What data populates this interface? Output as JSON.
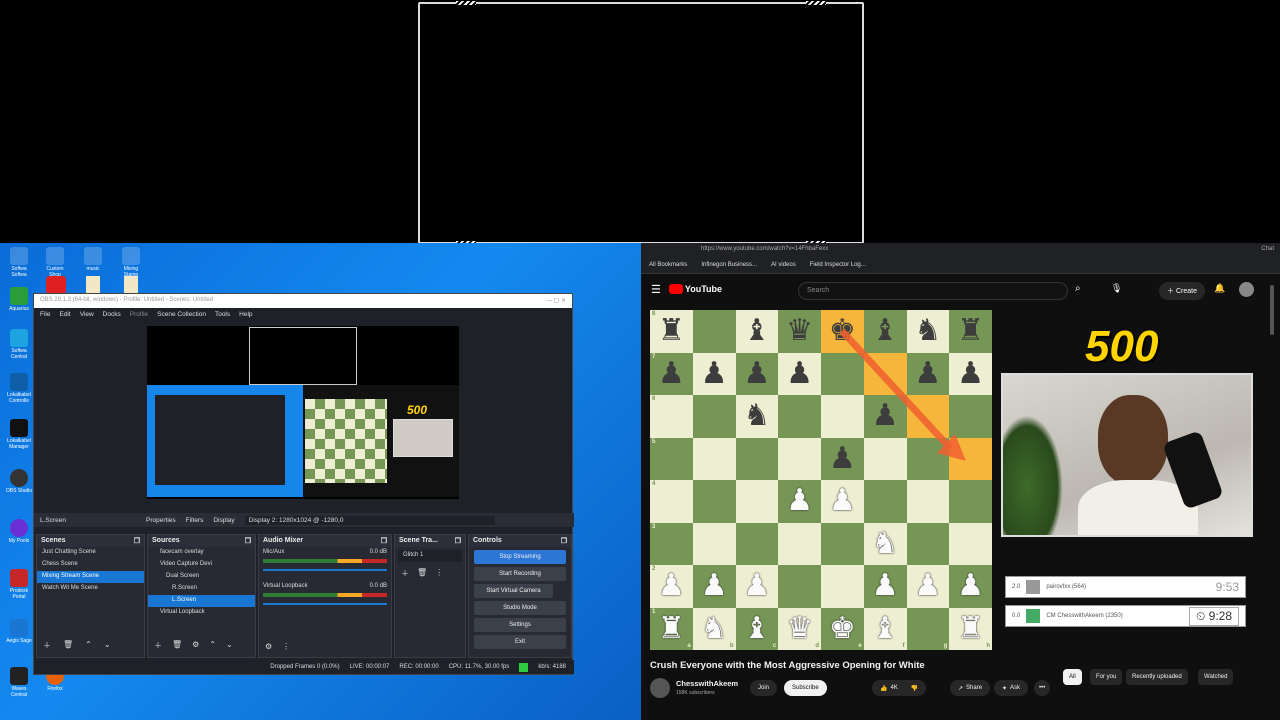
{
  "desktop_icons": [
    {
      "label": "Softwa Softwa"
    },
    {
      "label": "Custom Shop"
    },
    {
      "label": "music"
    },
    {
      "label": "Mixing Stamp"
    },
    {
      "label": "Aquarius"
    },
    {
      "label": "Softwa Central"
    },
    {
      "label": "Lokalkabel Controlle"
    },
    {
      "label": "Lokalkabel Manager"
    },
    {
      "label": "OBS Studio"
    },
    {
      "label": "My Pools"
    },
    {
      "label": "Prodesk Portal"
    },
    {
      "label": "Aegis Sage"
    },
    {
      "label": "Waves Central"
    },
    {
      "label": "Firefox"
    }
  ],
  "obs": {
    "title": "OBS 29.1.3 (64-bit, windows) - Profile: Untitled - Scenes: Untitled",
    "menu": [
      "File",
      "Edit",
      "View",
      "Docks",
      "Profile",
      "Scene Collection",
      "Tools",
      "Help"
    ],
    "source_bar": {
      "selected": "L.Screen",
      "properties": "Properties",
      "filters": "Filters",
      "display_label": "Display",
      "display_value": "Display 2: 1280x1024 @ -1280,0"
    },
    "scenes": {
      "title": "Scenes",
      "items": [
        "Just Chatting Scene",
        "Chess Scene",
        "Mixing Stream Scene",
        "Watch Wit Me Scene"
      ],
      "selected_index": 2
    },
    "sources": {
      "title": "Sources",
      "items": [
        "facecam overlay",
        "Video Capture Devi",
        "Dual Screen",
        "R.Screen",
        "L.Screen",
        "Virtual Loopback"
      ],
      "selected_index": 4
    },
    "audio": {
      "title": "Audio Mixer",
      "channels": [
        {
          "name": "Mic/Aux",
          "db": "0.0 dB"
        },
        {
          "name": "Virtual Loopback",
          "db": "0.0 dB"
        }
      ]
    },
    "transitions": {
      "title": "Scene Tra...",
      "value": "Glitch 1"
    },
    "controls": {
      "title": "Controls",
      "buttons": [
        "Stop Streaming",
        "Start Recording",
        "Start Virtual Camera",
        "Studio Mode",
        "Settings",
        "Exit"
      ]
    },
    "status": {
      "dropped": "Dropped Frames 0 (0.0%)",
      "live": "LIVE: 00:00:07",
      "rec": "REC: 00:00:00",
      "cpu": "CPU: 11.7%, 30.00 fps",
      "kbps": "kb/s: 4188"
    }
  },
  "browser": {
    "url": "https://www.youtube.com/watch?v=14FhbaFexx",
    "bookmarks": [
      "All Bookmarks",
      "Infinegon Business...",
      "AI videos",
      "Field Inspector Log..."
    ],
    "chat_label": "Chat",
    "youtube": {
      "logo": "YouTube",
      "search_placeholder": "Search",
      "create": "Create"
    },
    "score_overlay": "500",
    "players": [
      {
        "rating_badge": "2.0",
        "name": "pairovfxx (564)",
        "clock": "9:53"
      },
      {
        "rating_badge": "0.0",
        "name": "CM ChesswithAkeem (2350)",
        "clock": "9:28"
      }
    ],
    "video_title": "Crush Everyone with the Most Aggressive Opening for White",
    "channel": {
      "name": "ChesswithAkeem",
      "subs": "158K subscribers",
      "join": "Join",
      "subscribe": "Subscribe"
    },
    "actions": {
      "likes": "4K",
      "share": "Share",
      "ask": "Ask"
    },
    "chips": [
      "All",
      "For you",
      "Recently uploaded",
      "Watched"
    ],
    "board": {
      "rows": [
        [
          "bR",
          "",
          "bB",
          "bQ",
          "bK",
          "bB",
          "bN",
          "bR"
        ],
        [
          "bP",
          "bP",
          "bP",
          "bP",
          "",
          "",
          "bP",
          "bP"
        ],
        [
          "",
          "",
          "bN",
          "",
          "",
          "bP",
          "",
          ""
        ],
        [
          "",
          "",
          "",
          "",
          "bP",
          "",
          "",
          ""
        ],
        [
          "",
          "",
          "",
          "wP",
          "wP",
          "",
          "",
          ""
        ],
        [
          "",
          "",
          "",
          "",
          "",
          "wN",
          "",
          ""
        ],
        [
          "wP",
          "wP",
          "wP",
          "",
          "",
          "wP",
          "wP",
          "wP"
        ],
        [
          "wR",
          "wN",
          "wB",
          "wQ",
          "wK",
          "wB",
          "",
          "wR"
        ]
      ],
      "highlights": [
        "e8",
        "f7",
        "g6",
        "h5"
      ],
      "files": [
        "a",
        "b",
        "c",
        "d",
        "e",
        "f",
        "g",
        "h"
      ],
      "ranks": [
        "8",
        "7",
        "6",
        "5",
        "4",
        "3",
        "2",
        "1"
      ]
    }
  }
}
